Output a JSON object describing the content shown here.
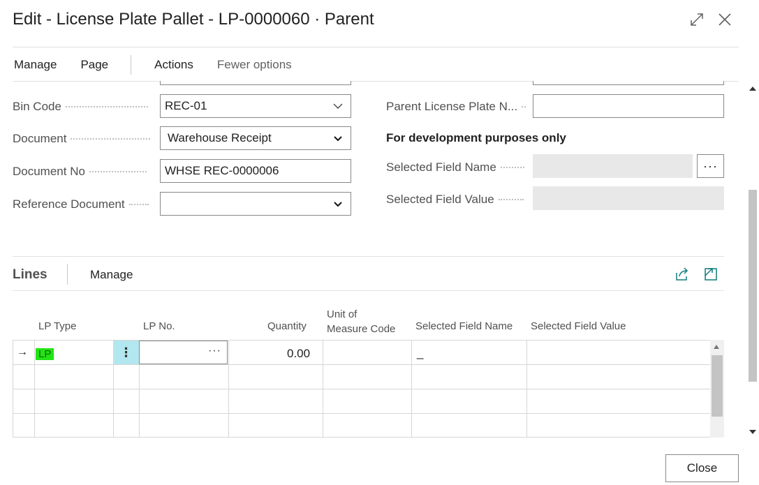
{
  "window": {
    "title": "Edit - License Plate Pallet - LP-0000060 · Parent",
    "icons": {
      "expand": "expand-icon",
      "close": "close-icon"
    }
  },
  "menu": {
    "items": [
      "Manage",
      "Page",
      "Actions",
      "Fewer options"
    ]
  },
  "fields_left": [
    {
      "label": "Bin Code",
      "value": "REC-01",
      "kind": "lookup"
    },
    {
      "label": "Document",
      "value": "Warehouse Receipt",
      "kind": "select"
    },
    {
      "label": "Document No",
      "value": "WHSE REC-0000006",
      "kind": "text"
    },
    {
      "label": "Reference Document",
      "value": "",
      "kind": "select"
    }
  ],
  "fields_right": {
    "parent_lp": {
      "label": "Parent License Plate N...",
      "value": ""
    },
    "dev_section_title": "For development purposes only",
    "selected_field_name": {
      "label": "Selected Field Name",
      "value": "",
      "button": "···"
    },
    "selected_field_value": {
      "label": "Selected Field Value",
      "value": ""
    }
  },
  "lines": {
    "title": "Lines",
    "manage_label": "Manage",
    "icons": [
      "share-icon",
      "open-in-new-window-icon"
    ],
    "columns": [
      "LP Type",
      "LP No.",
      "Quantity",
      "Unit of Measure Code",
      "Selected Field Name",
      "Selected Field Value"
    ],
    "column_header_uom": [
      "Unit of",
      "Measure Code"
    ],
    "rows": [
      {
        "lp_type": "LP",
        "lp_no": "",
        "quantity": "0.00",
        "uom": "",
        "sel_name": "_",
        "sel_value": "",
        "current": true
      }
    ],
    "row_indicator": "→",
    "lookup_ellipsis": "···",
    "context_menu": "⋮"
  },
  "footer": {
    "close_label": "Close"
  },
  "colors": {
    "lp_highlight": "#22e414",
    "context_cell": "#b2e7ef",
    "readonly_field": "#e8e8e9"
  }
}
